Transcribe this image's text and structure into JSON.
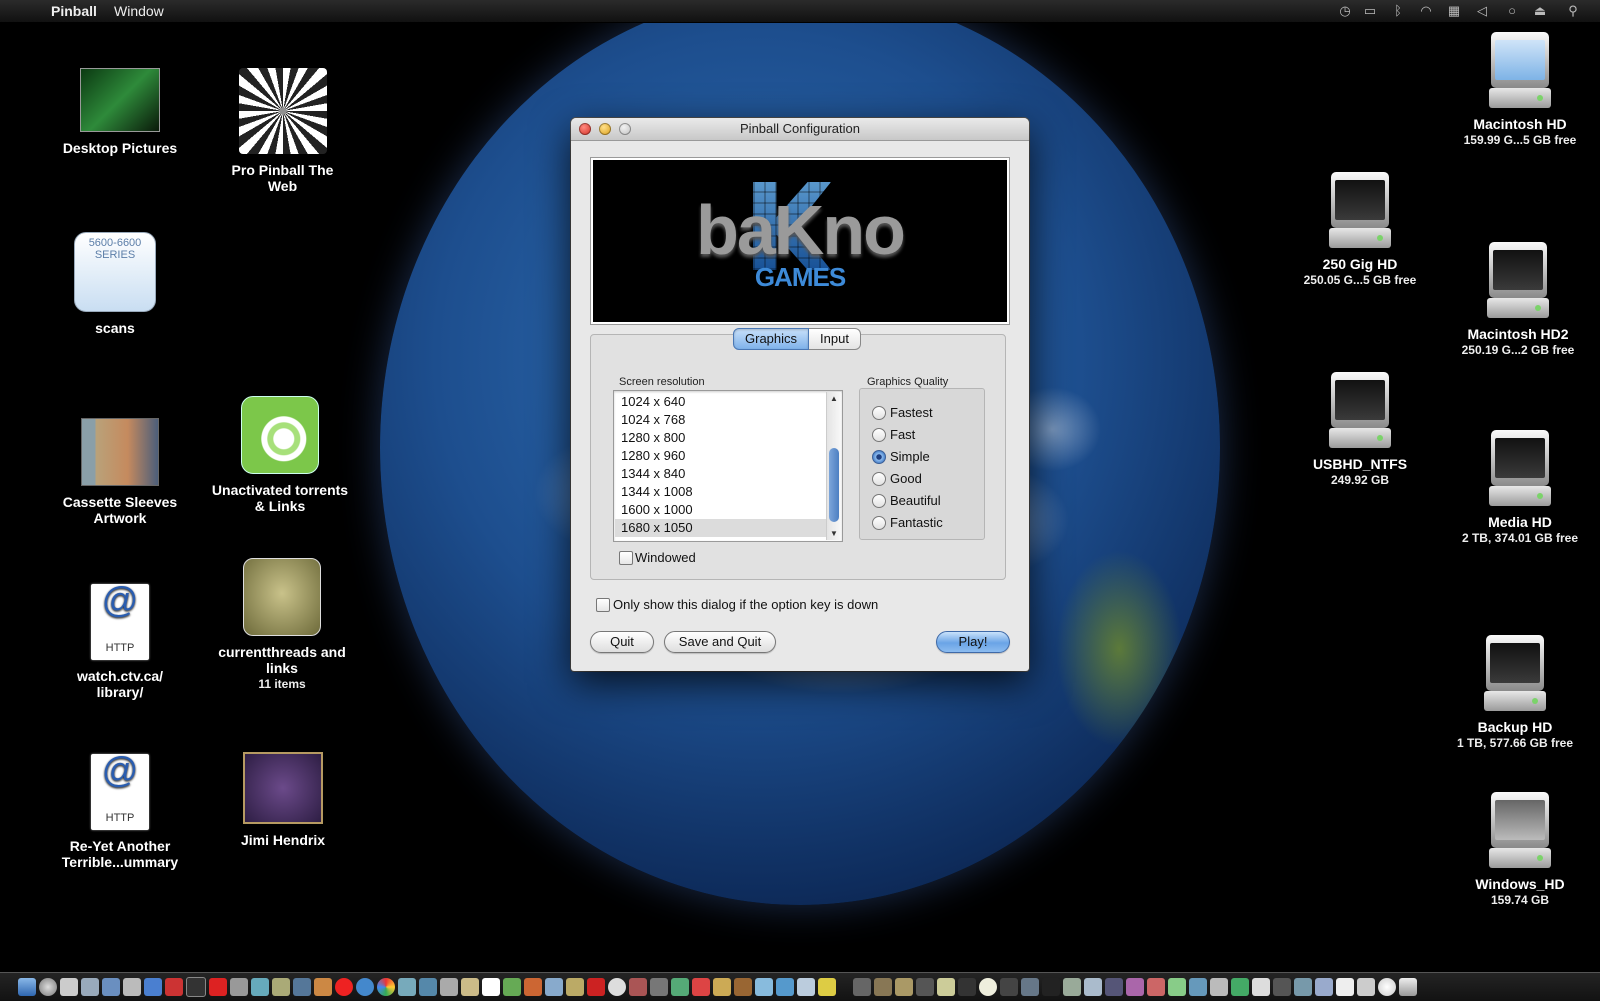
{
  "menubar": {
    "app_name": "Pinball",
    "menu_window": "Window",
    "status_icons": [
      "time-machine-icon",
      "display-icon",
      "bluetooth-icon",
      "wifi-icon",
      "keyboard-input-icon",
      "volume-icon",
      "sync-icon",
      "eject-icon",
      "spotlight-icon"
    ]
  },
  "desktop_left": [
    {
      "name": "Desktop Pictures",
      "sub": ""
    },
    {
      "name": "Pro Pinball The Web",
      "sub": ""
    },
    {
      "name": "scans",
      "sub": "",
      "image_text": "5600-6600 SERIES"
    },
    {
      "name": "Cassette Sleeves Artwork",
      "sub": ""
    },
    {
      "name": "Unactivated torrents & Links",
      "sub": ""
    },
    {
      "name": "watch.ctv.ca/ library/",
      "sub": "",
      "image_text": "HTTP"
    },
    {
      "name": "currentthreads and links",
      "sub": "11 items"
    },
    {
      "name": "Re-Yet Another Terrible...ummary",
      "sub": "",
      "image_text": "HTTP"
    },
    {
      "name": "Jimi Hendrix",
      "sub": ""
    }
  ],
  "desktop_right": [
    {
      "name": "Macintosh HD",
      "sub": "159.99 G...5 GB free"
    },
    {
      "name": "250 Gig HD",
      "sub": "250.05 G...5 GB free"
    },
    {
      "name": "Macintosh HD2",
      "sub": "250.19 G...2 GB free"
    },
    {
      "name": "USBHD_NTFS",
      "sub": "249.92 GB"
    },
    {
      "name": "Media HD",
      "sub": "2 TB, 374.01 GB free"
    },
    {
      "name": "Backup HD",
      "sub": "1 TB, 577.66 GB free"
    },
    {
      "name": "Windows_HD",
      "sub": "159.74 GB"
    }
  ],
  "dialog": {
    "title": "Pinball Configuration",
    "banner": {
      "wordmark": "baKno",
      "games": "GAMES"
    },
    "tabs": [
      {
        "label": "Graphics",
        "selected": true
      },
      {
        "label": "Input",
        "selected": false
      }
    ],
    "resolution_label": "Screen resolution",
    "resolutions": [
      "1024 x 640",
      "1024 x 768",
      "1280 x 800",
      "1280 x 960",
      "1344 x 840",
      "1344 x 1008",
      "1600 x 1000",
      "1680 x 1050"
    ],
    "selected_resolution": "1680 x 1050",
    "windowed_label": "Windowed",
    "windowed_checked": false,
    "quality_label": "Graphics Quality",
    "quality_options": [
      "Fastest",
      "Fast",
      "Simple",
      "Good",
      "Beautiful",
      "Fantastic"
    ],
    "quality_selected": "Simple",
    "option_key_label": "Only show this dialog if the option key is down",
    "option_key_checked": false,
    "buttons": {
      "quit": "Quit",
      "save_quit": "Save and Quit",
      "play": "Play!"
    }
  },
  "colors": {
    "accent_blue": "#5b97e0",
    "banner_blue": "#3d8ad8",
    "desktop_bg": "#000000"
  }
}
